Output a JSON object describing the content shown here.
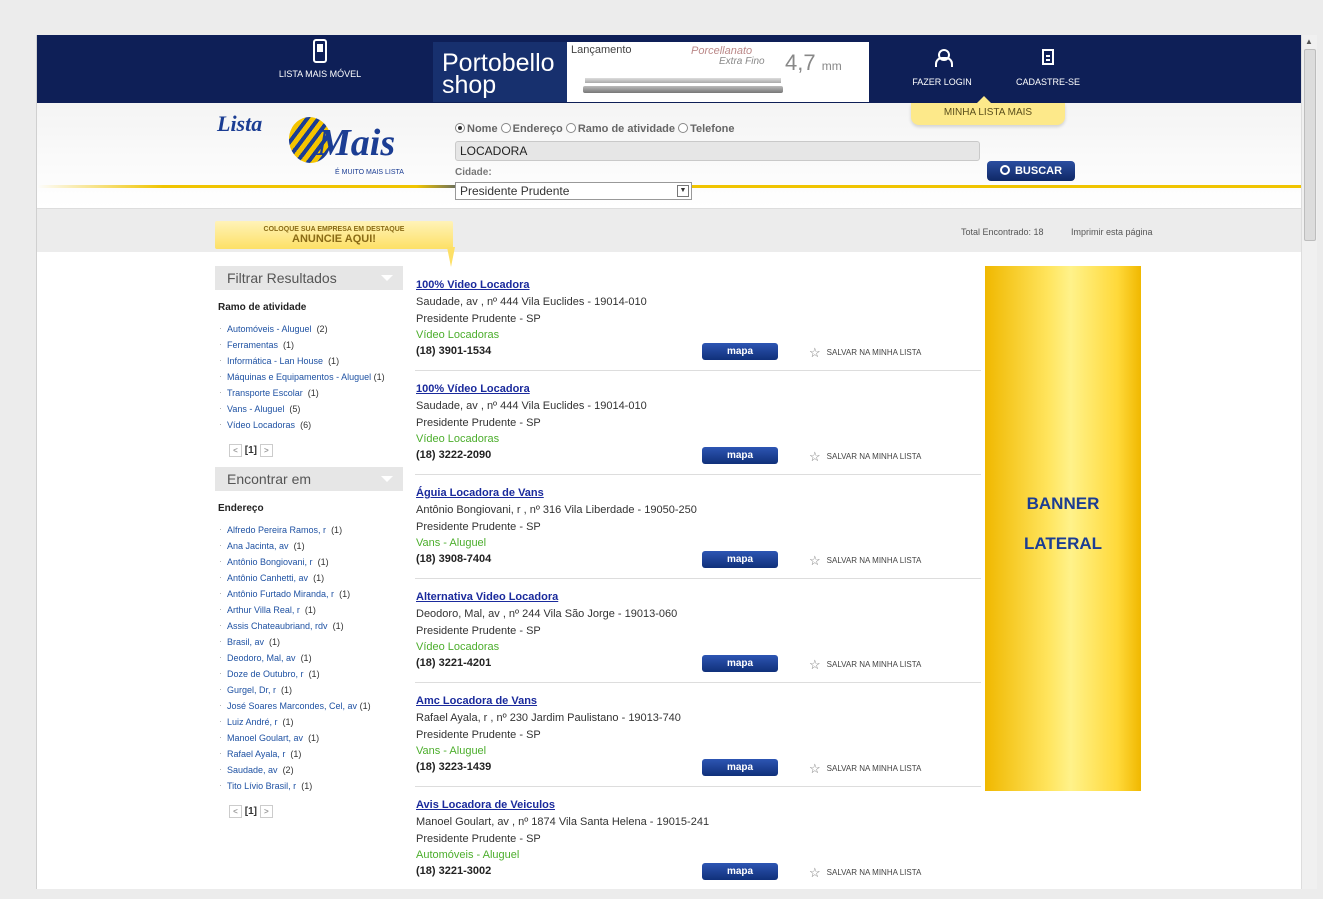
{
  "topbar": {
    "mobile_label": "LISTA MAIS MÓVEL",
    "login_label": "FAZER LOGIN",
    "register_label": "CADASTRE-SE",
    "ad": {
      "brand_line1": "Portobello",
      "brand_line2": "shop",
      "launch": "Lançamento",
      "tagline": "Porcellanato",
      "tagline2": "Extra Fino",
      "size": "4,7",
      "size_unit": "mm"
    }
  },
  "header": {
    "minha_lista": "MINHA LISTA MAIS",
    "logo_word1": "Lista",
    "logo_word2": "Mais",
    "logo_slogan": "É MUITO MAIS LISTA",
    "search_options": [
      "Nome",
      "Endereço",
      "Ramo de atividade",
      "Telefone"
    ],
    "query": "LOCADORA",
    "search_button": "BUSCAR",
    "city_label": "Cidade:",
    "city_value": "Presidente Prudente"
  },
  "bar": {
    "anuncie_small": "COLOQUE SUA EMPRESA EM DESTAQUE",
    "anuncie_big": "ANUNCIE AQUI!",
    "total": "Total Encontrado: 18",
    "print": "Imprimir esta página"
  },
  "sidebar": {
    "filter_title": "Filtrar Resultados",
    "ramo_title": "Ramo de atividade",
    "ramo_items": [
      {
        "label": "Automóveis - Aluguel",
        "count": "(2)"
      },
      {
        "label": "Ferramentas",
        "count": "(1)"
      },
      {
        "label": "Informática - Lan House",
        "count": "(1)"
      },
      {
        "label": "Máquinas e Equipamentos - Aluguel",
        "count": "(1)"
      },
      {
        "label": "Transporte Escolar",
        "count": "(1)"
      },
      {
        "label": "Vans - Aluguel",
        "count": "(5)"
      },
      {
        "label": "Vídeo Locadoras",
        "count": "(6)"
      }
    ],
    "page": "[1]",
    "encontrar_title": "Encontrar em",
    "endereco_title": "Endereço",
    "endereco_items": [
      {
        "label": "Alfredo Pereira Ramos, r",
        "count": "(1)"
      },
      {
        "label": "Ana Jacinta, av",
        "count": "(1)"
      },
      {
        "label": "Antônio Bongiovani, r",
        "count": "(1)"
      },
      {
        "label": "Antônio Canhetti, av",
        "count": "(1)"
      },
      {
        "label": "Antônio Furtado Miranda, r",
        "count": "(1)"
      },
      {
        "label": "Arthur Villa Real, r",
        "count": "(1)"
      },
      {
        "label": "Assis Chateaubriand, rdv",
        "count": "(1)"
      },
      {
        "label": "Brasil, av",
        "count": "(1)"
      },
      {
        "label": "Deodoro, Mal, av",
        "count": "(1)"
      },
      {
        "label": "Doze de Outubro, r",
        "count": "(1)"
      },
      {
        "label": "Gurgel, Dr, r",
        "count": "(1)"
      },
      {
        "label": "José Soares Marcondes, Cel, av",
        "count": "(1)"
      },
      {
        "label": "Luiz André, r",
        "count": "(1)"
      },
      {
        "label": "Manoel Goulart, av",
        "count": "(1)"
      },
      {
        "label": "Rafael Ayala, r",
        "count": "(1)"
      },
      {
        "label": "Saudade, av",
        "count": "(2)"
      },
      {
        "label": "Tito Lívio Brasil, r",
        "count": "(1)"
      }
    ]
  },
  "results": [
    {
      "name": "100% Video Locadora",
      "address": "Saudade, av , nº 444 Vila Euclides  -  19014-010",
      "city": "Presidente Prudente  -  SP",
      "category": "Vídeo Locadoras",
      "phone": "(18) 3901-1534"
    },
    {
      "name": "100% Vídeo Locadora",
      "address": "Saudade, av , nº 444 Vila Euclides  -  19014-010",
      "city": "Presidente Prudente  -  SP",
      "category": "Vídeo Locadoras",
      "phone": "(18) 3222-2090"
    },
    {
      "name": "Águia Locadora de Vans",
      "address": "Antônio Bongiovani, r , nº 316 Vila Liberdade  -  19050-250",
      "city": "Presidente Prudente  -  SP",
      "category": "Vans - Aluguel",
      "phone": "(18) 3908-7404"
    },
    {
      "name": "Alternativa Video Locadora",
      "address": "Deodoro, Mal, av , nº 244 Vila São Jorge  -  19013-060",
      "city": "Presidente Prudente  -  SP",
      "category": "Vídeo Locadoras",
      "phone": "(18) 3221-4201"
    },
    {
      "name": "Amc Locadora de Vans",
      "address": "Rafael Ayala, r , nº 230 Jardim Paulistano  -  19013-740",
      "city": "Presidente Prudente  -  SP",
      "category": "Vans - Aluguel",
      "phone": "(18) 3223-1439"
    },
    {
      "name": "Avis Locadora de Veiculos",
      "address": "Manoel Goulart, av , nº 1874 Vila Santa Helena  -  19015-241",
      "city": "Presidente Prudente  -  SP",
      "category": "Automóveis - Aluguel",
      "phone": "(18) 3221-3002"
    }
  ],
  "result_labels": {
    "map": "mapa",
    "save": "SALVAR NA MINHA LISTA"
  },
  "banner": {
    "line1": "BANNER",
    "line2": "LATERAL"
  }
}
